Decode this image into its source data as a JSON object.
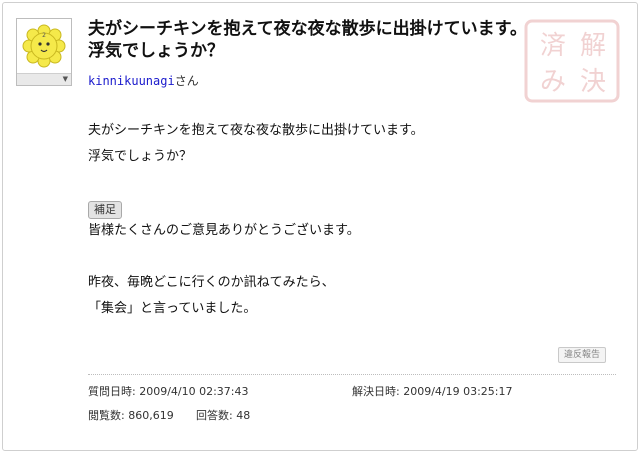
{
  "question": {
    "title": "夫がシーチキンを抱えて夜な夜な散歩に出掛けています。浮気でしょうか？",
    "asker_id": "kinnikuunagi",
    "asker_suffix": "さん",
    "body_lines": [
      "夫がシーチキンを抱えて夜な夜な散歩に出掛けています。",
      "浮気でしょうか？"
    ]
  },
  "stamp": {
    "text_lines": [
      "解",
      "済",
      "み",
      "決"
    ],
    "color": "#d98080"
  },
  "supplement": {
    "badge": "補足",
    "lines": [
      "皆様たくさんのご意見ありがとうございます。",
      "",
      "昨夜、毎晩どこに行くのか訊ねてみたら、",
      "「集会」と言っていました。"
    ]
  },
  "report_button": "違反報告",
  "meta": {
    "asked_label": "質問日時",
    "asked_value": "2009/4/10 02:37:43",
    "resolved_label": "解決日時",
    "resolved_value": "2009/4/19 03:25:17",
    "views_label": "閲覧数",
    "views_value": "860,619",
    "answers_label": "回答数",
    "answers_value": "48"
  },
  "avatar": {
    "icon": "yellow-flower-character-icon",
    "color": "#f5e94a",
    "menu_icon": "dropdown-arrow-icon"
  }
}
